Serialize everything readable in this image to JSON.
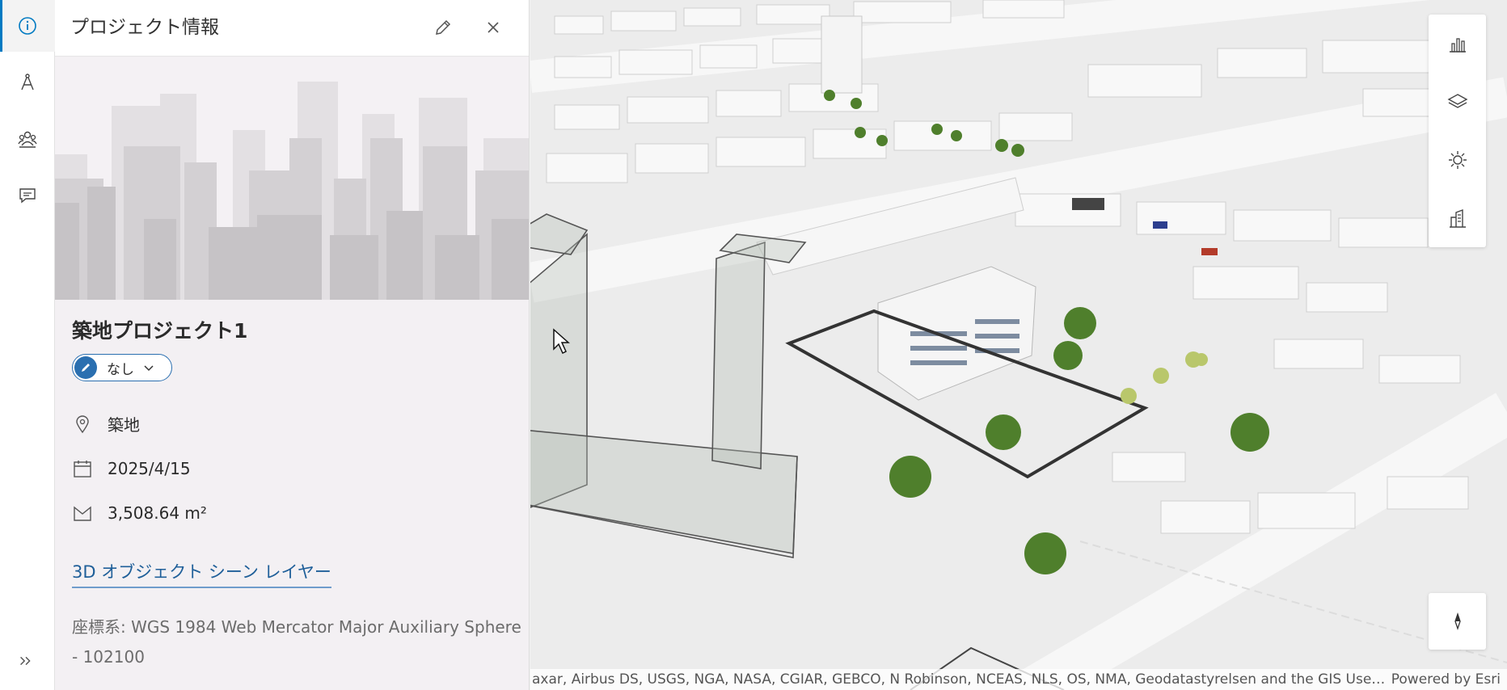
{
  "panel": {
    "title": "プロジェクト情報",
    "project_name": "築地プロジェクト1",
    "status_label": "なし",
    "location": "築地",
    "date": "2025/4/15",
    "area_value": "3,508.64 m²",
    "layer_link": "3D オブジェクト シーン レイヤー",
    "crs": "座標系: WGS 1984 Web Mercator Major Auxiliary Sphere - 102100"
  },
  "rail": {
    "items": [
      {
        "icon": "info-icon",
        "active": true
      },
      {
        "icon": "compass-drafting-icon",
        "active": false
      },
      {
        "icon": "people-icon",
        "active": false
      },
      {
        "icon": "comment-icon",
        "active": false
      }
    ],
    "expand_icon": "double-chevron-right-icon"
  },
  "map": {
    "attribution": "axar, Airbus DS, USGS, NGA, NASA, CGIAR, GEBCO, N Robinson, NCEAS, NLS, OS, NMA, Geodatastyrelsen and the GIS User Com...",
    "powered_by": "Powered by Esri",
    "tools": [
      "chart-icon",
      "layers-icon",
      "daylight-icon",
      "building-stats-icon"
    ],
    "compass_icon": "compass-icon"
  },
  "colors": {
    "accent": "#007ac2",
    "chip_blue": "#2a6fb0",
    "link": "#1f5f99"
  }
}
